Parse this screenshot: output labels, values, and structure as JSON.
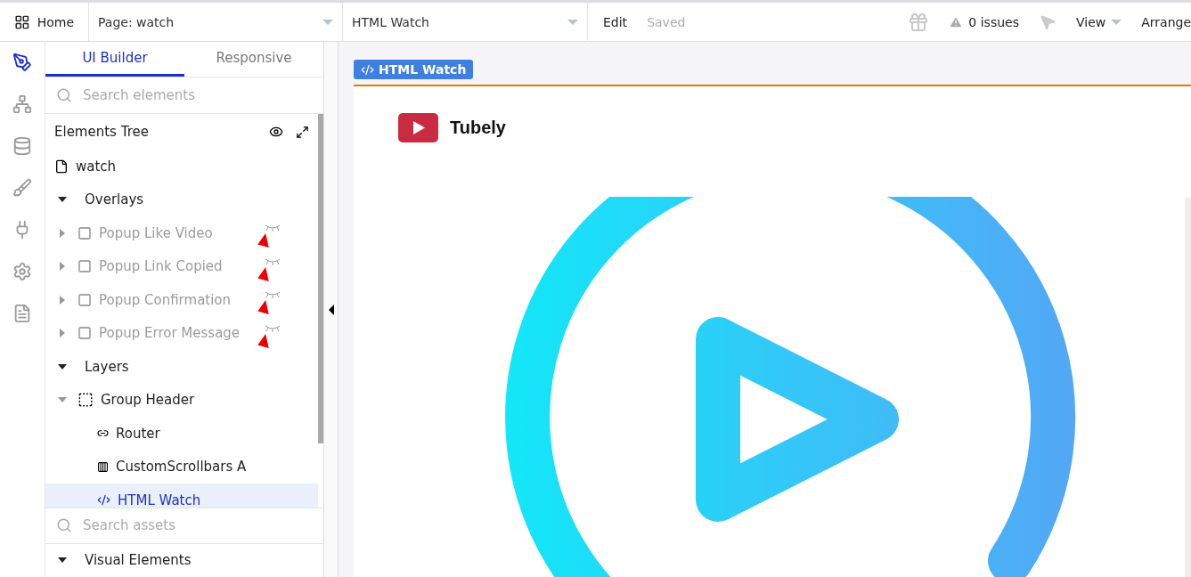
{
  "topbar": {
    "home": "Home",
    "page_dropdown": "Page: watch",
    "element_dropdown": "HTML Watch",
    "edit": "Edit",
    "save_status": "Saved",
    "issues": "0 issues",
    "view": "View",
    "arrange": "Arrange"
  },
  "rail": [
    {
      "kind": "design",
      "selected": true
    },
    {
      "kind": "workflow",
      "selected": false
    },
    {
      "kind": "data",
      "selected": false
    },
    {
      "kind": "styles",
      "selected": false
    },
    {
      "kind": "plugins",
      "selected": false
    },
    {
      "kind": "settings",
      "selected": false
    },
    {
      "kind": "logs",
      "selected": false
    }
  ],
  "tabs": [
    {
      "label": "UI Builder",
      "selected": true
    },
    {
      "label": "Responsive",
      "selected": false
    }
  ],
  "search": {
    "placeholder": "Search elements"
  },
  "tree_title": "Elements Tree",
  "tree": [
    {
      "label": "watch",
      "kind": "page",
      "selected": false
    },
    {
      "label": "Overlays",
      "kind": "section",
      "expanded": true,
      "children": [
        {
          "label": "Popup Like Video",
          "kind": "popup",
          "hidden": true,
          "expanded": false,
          "selected": false,
          "annotated": true
        },
        {
          "label": "Popup Link Copied",
          "kind": "popup",
          "hidden": true,
          "expanded": false,
          "selected": false,
          "annotated": true
        },
        {
          "label": "Popup Confirmation",
          "kind": "popup",
          "hidden": true,
          "expanded": false,
          "selected": false,
          "annotated": true
        },
        {
          "label": "Popup Error Message",
          "kind": "popup",
          "hidden": true,
          "expanded": false,
          "selected": false,
          "annotated": true
        }
      ]
    },
    {
      "label": "Layers",
      "kind": "section",
      "expanded": true,
      "children": [
        {
          "label": "Group Header",
          "kind": "group",
          "expanded": true,
          "selected": false,
          "children": [
            {
              "label": "Router",
              "kind": "link",
              "selected": false
            },
            {
              "label": "CustomScrollbars A",
              "kind": "scrollbars",
              "selected": false
            },
            {
              "label": "HTML Watch",
              "kind": "html",
              "selected": true
            }
          ]
        }
      ]
    }
  ],
  "assets_search": {
    "placeholder": "Search assets"
  },
  "assets_section": {
    "label": "Visual Elements",
    "expanded": true
  },
  "canvas": {
    "element_tag": "HTML Watch",
    "brand": "Tubely"
  }
}
